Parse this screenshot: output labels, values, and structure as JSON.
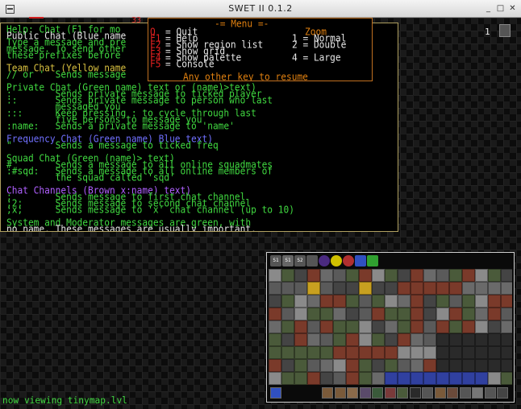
{
  "window": {
    "title": "SWET II 0.1.2"
  },
  "overlay": {
    "red_counter": "33",
    "zoom_level": "1"
  },
  "help": {
    "lines": [
      {
        "text": "Help: Chat (F1 for mo",
        "color": "green"
      },
      {
        "text": "Public Chat (Blue name",
        "color": "white"
      },
      {
        "text": "Type a message and pre",
        "color": "green"
      },
      {
        "text": "message. To send other",
        "color": "green"
      },
      {
        "text": "these prefixes before",
        "color": "green"
      },
      {
        "text": "",
        "color": "green"
      },
      {
        "text": "Team Chat (Yellow name",
        "color": "yellow"
      },
      {
        "text": "// or '  Sends message",
        "color": "green"
      },
      {
        "text": "",
        "color": "green"
      },
      {
        "text": "Private Chat (Green name) text or (name)>text)",
        "color": "green"
      },
      {
        "text": ":        Sends private message to ticked player",
        "color": "green"
      },
      {
        "text": "::       Sends private message to person who last",
        "color": "green"
      },
      {
        "text": "         messaged you",
        "color": "green"
      },
      {
        "text": ":::      Keep pressing : to cycle through last",
        "color": "green"
      },
      {
        "text": "         five persons to message you",
        "color": "green"
      },
      {
        "text": ":name:   Sends a private message to 'name'",
        "color": "green"
      },
      {
        "text": "",
        "color": "green"
      },
      {
        "text": "Frequency Chat (Green name) Blue text)",
        "color": "blue"
      },
      {
        "text": "\"        Sends a message to ticked freq",
        "color": "green"
      },
      {
        "text": "",
        "color": "green"
      },
      {
        "text": "Squad Chat (Green (name)> text)",
        "color": "green"
      },
      {
        "text": "#        Sends a message to all online squadmates",
        "color": "green"
      },
      {
        "text": ":#sqd:   Sends a message to all online members of",
        "color": "green"
      },
      {
        "text": "         the squad called 'sqd'",
        "color": "green"
      },
      {
        "text": "",
        "color": "green"
      },
      {
        "text": "Chat Channels (Brown x:name) text)",
        "color": "purple"
      },
      {
        "text": ";        Sends message to first chat channel",
        "color": "green"
      },
      {
        "text": ";2;      Sends message to second chat channel",
        "color": "green"
      },
      {
        "text": ";x;      Sends message to 'x' chat channel (up to 10)",
        "color": "green"
      },
      {
        "text": "",
        "color": "green"
      },
      {
        "text": "System and Moderator messages are green, with",
        "color": "green"
      },
      {
        "text": "no name. These messages are usually important.",
        "color": "white"
      }
    ]
  },
  "menu": {
    "title": "-= Menu =-",
    "items": [
      {
        "key": "Q",
        "label": "= Quit"
      },
      {
        "key": "F1",
        "label": "= Help"
      },
      {
        "key": "F2",
        "label": "= Show region list"
      },
      {
        "key": "F3",
        "label": "= Show grid"
      },
      {
        "key": "F4",
        "label": "= Show palette"
      },
      {
        "key": "F5",
        "label": "= Console"
      }
    ],
    "zoom_title": "Zoom",
    "zoom_items": [
      "1 = Normal",
      "2 = Double",
      "4 = Large"
    ],
    "footer": "Any other key to resume"
  },
  "status": {
    "text": "now viewing tinymap.lvl"
  },
  "palette": {
    "top_labels": [
      "S1",
      "S1",
      "S2"
    ],
    "colors": {
      "metal": "#8a8a8a",
      "brick": "#7a3a2a",
      "moss": "#4a5a3a",
      "hazard": "#c8a020",
      "blue": "#3040a0"
    }
  }
}
